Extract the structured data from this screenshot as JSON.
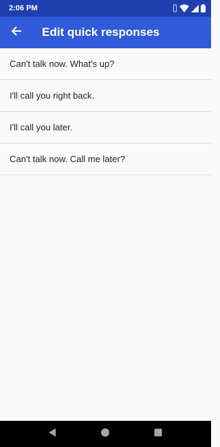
{
  "status_bar": {
    "time": "2:06 PM",
    "icons": [
      "vibrate-icon",
      "wifi-icon",
      "signal-icon",
      "battery-icon"
    ]
  },
  "app_bar": {
    "title": "Edit quick responses",
    "back_icon": "arrow-back-icon"
  },
  "responses": [
    "Can't talk now. What's up?",
    "I'll call you right back.",
    "I'll call you later.",
    "Can't talk now. Call me later?"
  ],
  "nav_bar": {
    "buttons": [
      "back-triangle-icon",
      "home-circle-icon",
      "recents-square-icon"
    ]
  },
  "colors": {
    "status_bar": "#1f3fae",
    "app_bar": "#2f5bd9",
    "background": "#fafafa",
    "divider": "#dcdcdc"
  }
}
